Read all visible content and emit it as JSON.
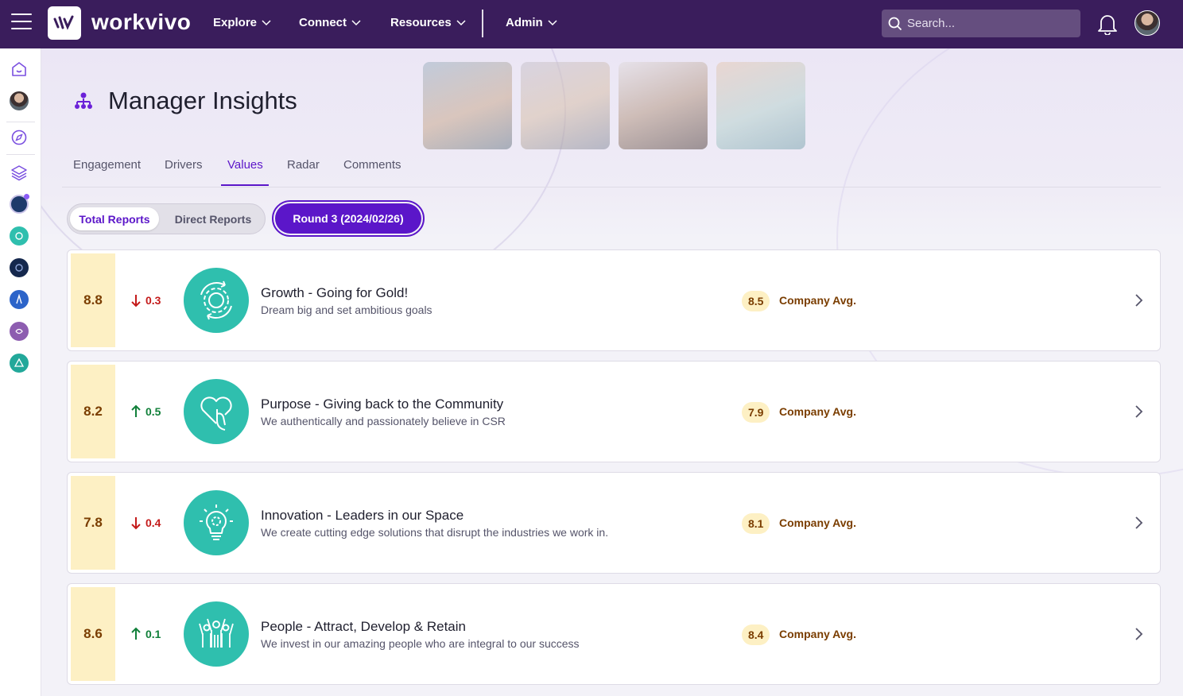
{
  "topbar": {
    "brand": "workvivo",
    "nav": [
      {
        "label": "Explore"
      },
      {
        "label": "Connect"
      },
      {
        "label": "Resources"
      },
      {
        "label": "Admin"
      }
    ],
    "search_placeholder": "Search..."
  },
  "page": {
    "title": "Manager Insights",
    "tabs": [
      {
        "label": "Engagement",
        "active": false
      },
      {
        "label": "Drivers",
        "active": false
      },
      {
        "label": "Values",
        "active": true
      },
      {
        "label": "Radar",
        "active": false
      },
      {
        "label": "Comments",
        "active": false
      }
    ],
    "toggle": {
      "option_on": "Total Reports",
      "option_off": "Direct Reports"
    },
    "round_label": "Round 3 (2024/02/26)"
  },
  "values": [
    {
      "score": "8.8",
      "trend": "down",
      "delta": "0.3",
      "icon": "gear-cycle-icon",
      "title": "Growth - Going for Gold!",
      "description": "Dream big and set ambitious goals",
      "company_avg": "8.5",
      "company_avg_label": "Company Avg."
    },
    {
      "score": "8.2",
      "trend": "up",
      "delta": "0.5",
      "icon": "heart-hand-icon",
      "title": "Purpose - Giving back to the Community",
      "description": "We authentically and passionately believe in CSR",
      "company_avg": "7.9",
      "company_avg_label": "Company Avg."
    },
    {
      "score": "7.8",
      "trend": "down",
      "delta": "0.4",
      "icon": "lightbulb-gear-icon",
      "title": "Innovation - Leaders in our Space",
      "description": "We create cutting edge solutions that disrupt the industries we work in.",
      "company_avg": "8.1",
      "company_avg_label": "Company Avg."
    },
    {
      "score": "8.6",
      "trend": "up",
      "delta": "0.1",
      "icon": "people-raised-hands-icon",
      "title": "People - Attract, Develop & Retain",
      "description": "We invest in our amazing people who are integral to our success",
      "company_avg": "8.4",
      "company_avg_label": "Company Avg."
    }
  ],
  "colors": {
    "topbar": "#3a1d5c",
    "accent": "#5b16c9",
    "teal_icon": "#2fbfae",
    "score_bg": "#fdf0c4",
    "down": "#c41b1b",
    "up": "#11803a"
  }
}
